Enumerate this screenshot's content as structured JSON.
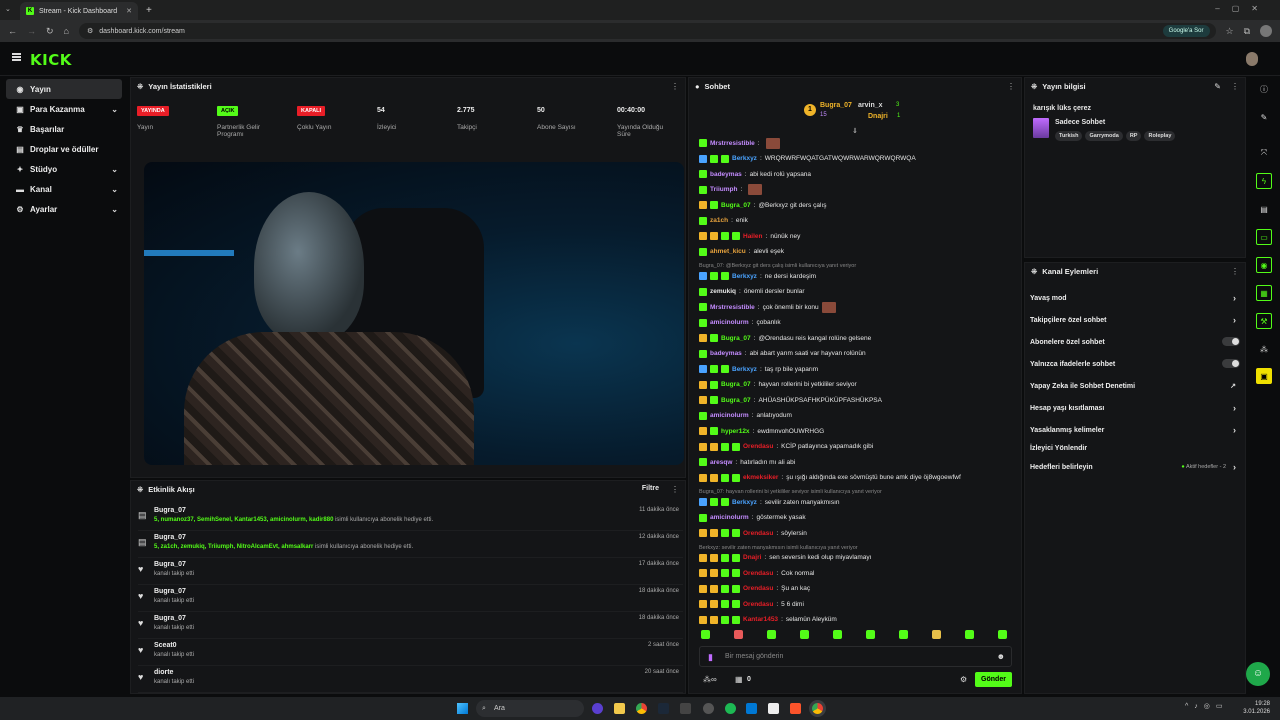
{
  "browser": {
    "tab_title": "Stream - Kick Dashboard",
    "url": "dashboard.kick.com/stream",
    "google_btn": "Google'a Sor"
  },
  "brand": {
    "logo": "KICK",
    "accent": "#53fc18"
  },
  "sidebar": {
    "items": [
      {
        "label": "Yayın",
        "icon": "broadcast-icon",
        "active": true
      },
      {
        "label": "Para Kazanma",
        "icon": "money-icon",
        "chevron": true
      },
      {
        "label": "Başarılar",
        "icon": "trophy-icon"
      },
      {
        "label": "Droplar ve ödüller",
        "icon": "gift-icon"
      },
      {
        "label": "Stüdyo",
        "icon": "studio-icon",
        "chevron": true
      },
      {
        "label": "Kanal",
        "icon": "channel-icon",
        "chevron": true
      },
      {
        "label": "Ayarlar",
        "icon": "gear-icon",
        "chevron": true
      }
    ]
  },
  "stats": {
    "title": "Yayın İstatistikleri",
    "items": [
      {
        "value": "YAYINDA",
        "label": "Yayın",
        "badge": "red"
      },
      {
        "value": "AÇIK",
        "label": "Partnerlik Gelir Programı",
        "badge": "green"
      },
      {
        "value": "KAPALI",
        "label": "Çoklu Yayın",
        "badge": "red"
      },
      {
        "value": "54",
        "label": "İzleyici"
      },
      {
        "value": "2.775",
        "label": "Takipçi"
      },
      {
        "value": "50",
        "label": "Abone Sayısı"
      },
      {
        "value": "00:40:00",
        "label": "Yayında Olduğu Süre"
      }
    ]
  },
  "events": {
    "title": "Etkinlik Akışı",
    "filter": "Filtre",
    "items": [
      {
        "name": "Bugra_07",
        "users": "5, numanoz37, SemihSenel, Kantar1453, amicinolurm, kadir880",
        "desc": " isimli kullanıcıya abonelik hediye etti.",
        "time": "11 dakika önce",
        "icon": "gift-sub-icon"
      },
      {
        "name": "Bugra_07",
        "users": "5, za1ch, zemukiq, Triiumph, NitroAlcamEvt, ahmsalkarr",
        "desc": " isimli kullanıcıya abonelik hediye etti.",
        "time": "12 dakika önce",
        "icon": "gift-sub-icon"
      },
      {
        "name": "Bugra_07",
        "users": "",
        "desc": "kanalı takip etti",
        "time": "17 dakika önce",
        "icon": "heart-icon"
      },
      {
        "name": "Bugra_07",
        "users": "",
        "desc": "kanalı takip etti",
        "time": "18 dakika önce",
        "icon": "heart-icon"
      },
      {
        "name": "Bugra_07",
        "users": "",
        "desc": "kanalı takip etti",
        "time": "18 dakika önce",
        "icon": "heart-icon"
      },
      {
        "name": "Sceat0",
        "users": "",
        "desc": "kanalı takip etti",
        "time": "2 saat önce",
        "icon": "heart-icon"
      },
      {
        "name": "diorte",
        "users": "",
        "desc": "kanalı takip etti",
        "time": "20 saat önce",
        "icon": "heart-icon"
      }
    ]
  },
  "chat": {
    "title": "Sohbet",
    "top_gifters": [
      {
        "rank": "1",
        "name": "Bugra_07",
        "count": "15"
      },
      {
        "rank": "",
        "name": "arvin_x",
        "count": "3"
      },
      {
        "rank": "",
        "name": "Dnajri",
        "count": "1"
      }
    ],
    "messages": [
      {
        "user": "Mrstrresistible",
        "color": "#c48cff",
        "text": "",
        "emote": true
      },
      {
        "user": "Berkxyz",
        "color": "#4aa3ff",
        "text": "WRQRWRFWQATGATWQWRWARWQRWQRWQA"
      },
      {
        "user": "badeymas",
        "color": "#c48cff",
        "text": "abi kedi rolü yapsana"
      },
      {
        "user": "Triiumph",
        "color": "#c48cff",
        "text": "",
        "emote": true
      },
      {
        "user": "Bugra_07",
        "color": "#53fc18",
        "text": "@Berkxyz git ders çalış"
      },
      {
        "user": "za1ch",
        "color": "#e8a33d",
        "text": "enik"
      },
      {
        "user": "Hailen",
        "color": "#e91e27",
        "text": "nünük ney"
      },
      {
        "user": "ahmet_kicu",
        "color": "#e8a33d",
        "text": "alevli eşek"
      },
      {
        "reply": "Bugra_07: @Berkxyz git ders çalış isimli kullanıcıya yanıt veriyor"
      },
      {
        "user": "Berkxyz",
        "color": "#4aa3ff",
        "text": "ne dersi kardeşim"
      },
      {
        "user": "zemukiq",
        "color": "#e8e8e8",
        "text": "önemli dersler bunlar"
      },
      {
        "user": "Mrstrresistible",
        "color": "#c48cff",
        "text": "çok önemli bir konu",
        "emote": true
      },
      {
        "user": "amicinolurm",
        "color": "#c48cff",
        "text": "çobanlık"
      },
      {
        "user": "Bugra_07",
        "color": "#53fc18",
        "text": "@Orendasu reis kangal rolüne gelsene"
      },
      {
        "user": "badeymas",
        "color": "#c48cff",
        "text": "abi abart yarım saati var hayvan rolünün"
      },
      {
        "user": "Berkxyz",
        "color": "#4aa3ff",
        "text": "taş rp bile yaparım"
      },
      {
        "user": "Bugra_07",
        "color": "#53fc18",
        "text": "hayvan rollerini bi yetkililer seviyor"
      },
      {
        "user": "Bugra_07",
        "color": "#53fc18",
        "text": "AHÜASHÜKPSAFHKPÜKÜPFASHÜKPSA"
      },
      {
        "user": "amicinolurm",
        "color": "#c48cff",
        "text": "anlatıyodum"
      },
      {
        "user": "hyper12x",
        "color": "#53fc18",
        "text": "ewdmnvohOUWRHGG"
      },
      {
        "user": "Orendasu",
        "color": "#e91e27",
        "text": "KCİP patlayınca yapamadık gibi"
      },
      {
        "user": "aresqw",
        "color": "#c48cff",
        "text": "hatırladın mı ali abi"
      },
      {
        "user": "ekmeksiker",
        "color": "#e91e27",
        "text": "şu ışığı aldığında exe sövmüştü bune amk diye öj8wgoewfwf"
      },
      {
        "reply": "Bugra_07: hayvan rollerini bi yetkililer seviyor isimli kullanıcıya yanıt veriyor"
      },
      {
        "user": "Berkxyz",
        "color": "#4aa3ff",
        "text": "sevilir zaten manyakmısın"
      },
      {
        "user": "amicinolurm",
        "color": "#c48cff",
        "text": "göstermek yasak"
      },
      {
        "user": "Orendasu",
        "color": "#e91e27",
        "text": "söylersin"
      },
      {
        "reply": "Berkxyz: sevilir zaten manyakmısın isimli kullanıcıya yanıt veriyor"
      },
      {
        "user": "Dnajri",
        "color": "#e91e27",
        "text": "sen seversin kedi olup miyavlamayı"
      },
      {
        "user": "Orendasu",
        "color": "#e91e27",
        "text": "Cok normal"
      },
      {
        "user": "Orendasu",
        "color": "#e91e27",
        "text": "Şu an kaç"
      },
      {
        "user": "Orendasu",
        "color": "#e91e27",
        "text": "5 6 dimi"
      },
      {
        "user": "Kantar1453",
        "color": "#e91e27",
        "text": "selamün Aleyküm"
      }
    ],
    "input_placeholder": "Bir mesaj gönderin",
    "send": "Gönder",
    "viewer_count": "0"
  },
  "stream_info": {
    "title": "Yayın bilgisi",
    "stream_title": "karışık lüks çerez",
    "category": "Sadece Sohbet",
    "tags": [
      "Turkish",
      "Garrymoda",
      "RP",
      "Roleplay"
    ]
  },
  "channel_actions": {
    "title": "Kanal Eylemleri",
    "items": [
      {
        "label": "Yavaş mod",
        "type": "arrow"
      },
      {
        "label": "Takipçilere özel sohbet",
        "type": "arrow"
      },
      {
        "label": "Abonelere özel sohbet",
        "type": "toggle"
      },
      {
        "label": "Yalnızca ifadelerle sohbet",
        "type": "toggle"
      },
      {
        "label": "Yapay Zeka ile Sohbet Denetimi",
        "type": "external"
      },
      {
        "label": "Hesap yaşı kısıtlaması",
        "type": "arrow"
      },
      {
        "label": "Yasaklanmış kelimeler",
        "type": "arrow"
      },
      {
        "label": "İzleyici Yönlendir",
        "type": "none"
      },
      {
        "label": "Hedefleri belirleyin",
        "type": "arrow",
        "extra": "Aktif hedefler - 2"
      }
    ]
  },
  "taskbar": {
    "search": "Ara",
    "time": "19:28",
    "date": "3.01.2026"
  }
}
